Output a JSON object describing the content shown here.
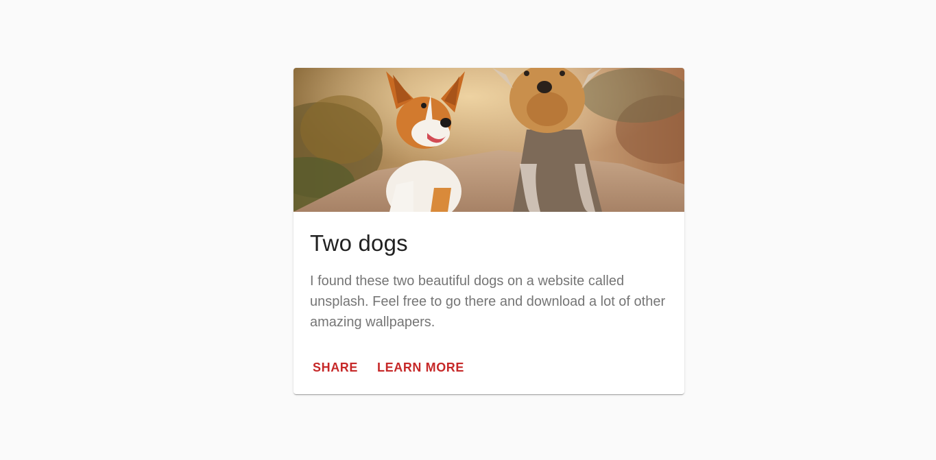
{
  "card": {
    "title": "Two dogs",
    "description": "I found these two beautiful dogs on a website called unsplash. Feel free to go there and download a lot of other amazing wallpapers.",
    "actions": {
      "share_label": "SHARE",
      "learn_more_label": "LEARN MORE"
    },
    "image_alt": "Corgi and Yorkshire terrier running on a dirt path",
    "accent_color": "#c62828"
  }
}
